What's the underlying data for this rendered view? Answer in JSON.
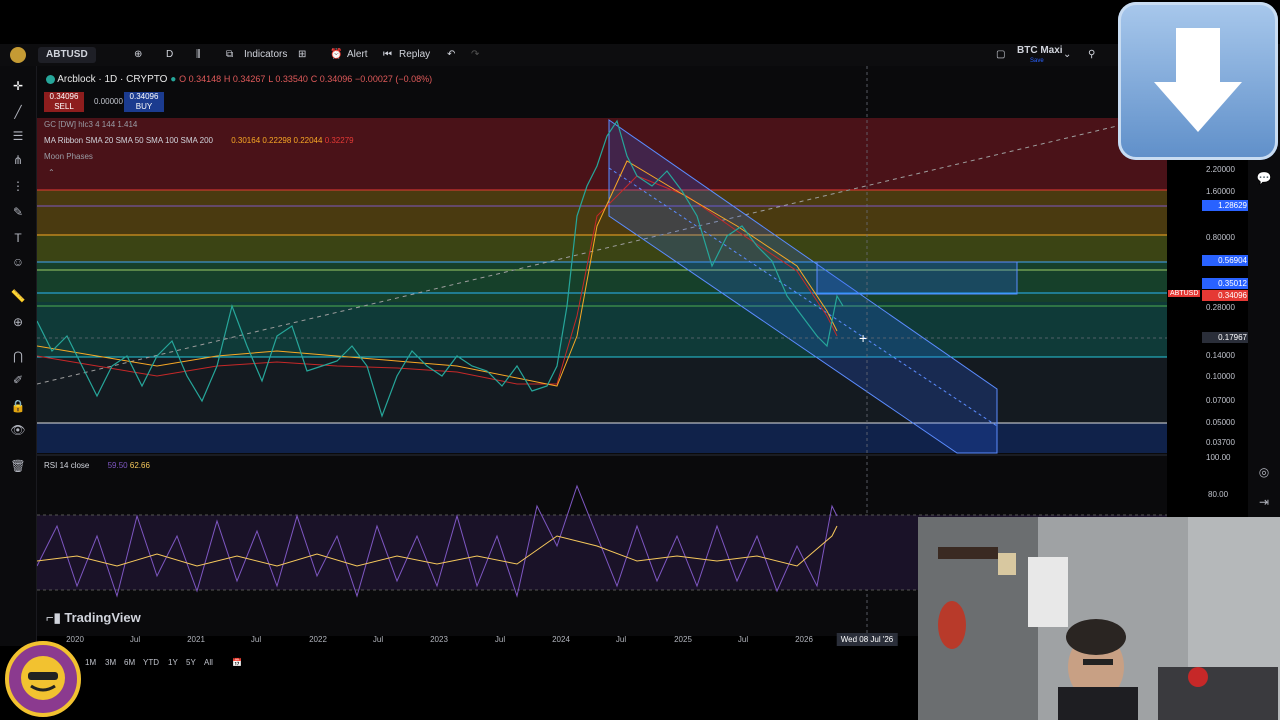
{
  "app": {
    "name": "TradingView",
    "watermark": "TradingView"
  },
  "toolbar": {
    "symbol": "ABTUSD",
    "interval": "D",
    "indicators_label": "Indicators",
    "alert_label": "Alert",
    "replay_label": "Replay",
    "layout_name": "BTC Maxi",
    "layout_status": "Save"
  },
  "legend": {
    "title": "Arcblock · 1D · CRYPTO",
    "open": "O 0.34148",
    "high": "H 0.34267",
    "low": "L 0.33540",
    "close": "C 0.34096",
    "change": "−0.00027 (−0.08%)",
    "sell_price": "0.34096",
    "sell_label": "SELL",
    "spread": "0.00000",
    "buy_price": "0.34096",
    "buy_label": "BUY",
    "indicators": [
      "GC [DW] hlc3 4 144 1.414",
      "MA Ribbon SMA 20 SMA 50 SMA 100 SMA 200",
      "Moon Phases"
    ],
    "ma_values": [
      "0.30164",
      "0.22298",
      "0.22044",
      "0.32279"
    ]
  },
  "price_axis": {
    "labels": [
      "2.20000",
      "1.60000",
      "0.80000",
      "0.28000",
      "0.14000",
      "0.10000",
      "0.07000",
      "0.05000",
      "0.03700",
      "100.00",
      "80.00"
    ],
    "badges": [
      {
        "text": "1.28629",
        "color": "#2962ff"
      },
      {
        "text": "0.56904",
        "color": "#2962ff"
      },
      {
        "text": "0.35012",
        "color": "#2962ff"
      },
      {
        "text": "0.34096",
        "color": "#e53935",
        "tag": "ABTUSD"
      },
      {
        "text": "0.17967",
        "color": "#2a2e39"
      }
    ]
  },
  "rsi": {
    "label": "RSI",
    "params": "14 close",
    "value1": "59.50",
    "value2": "62.66"
  },
  "time_axis": {
    "labels": [
      "2020",
      "Jul",
      "2021",
      "Jul",
      "2022",
      "Jul",
      "2023",
      "Jul",
      "2024",
      "Jul",
      "2025",
      "Jul",
      "2026"
    ],
    "crosshair": "Wed 08 Jul '26"
  },
  "ranges": [
    "1M",
    "3M",
    "6M",
    "YTD",
    "1Y",
    "5Y",
    "All"
  ],
  "colors": {
    "accent": "#2962ff",
    "down": "#e53935",
    "rsi": "#7e57c2",
    "rsi_ma": "#f7c95c"
  }
}
